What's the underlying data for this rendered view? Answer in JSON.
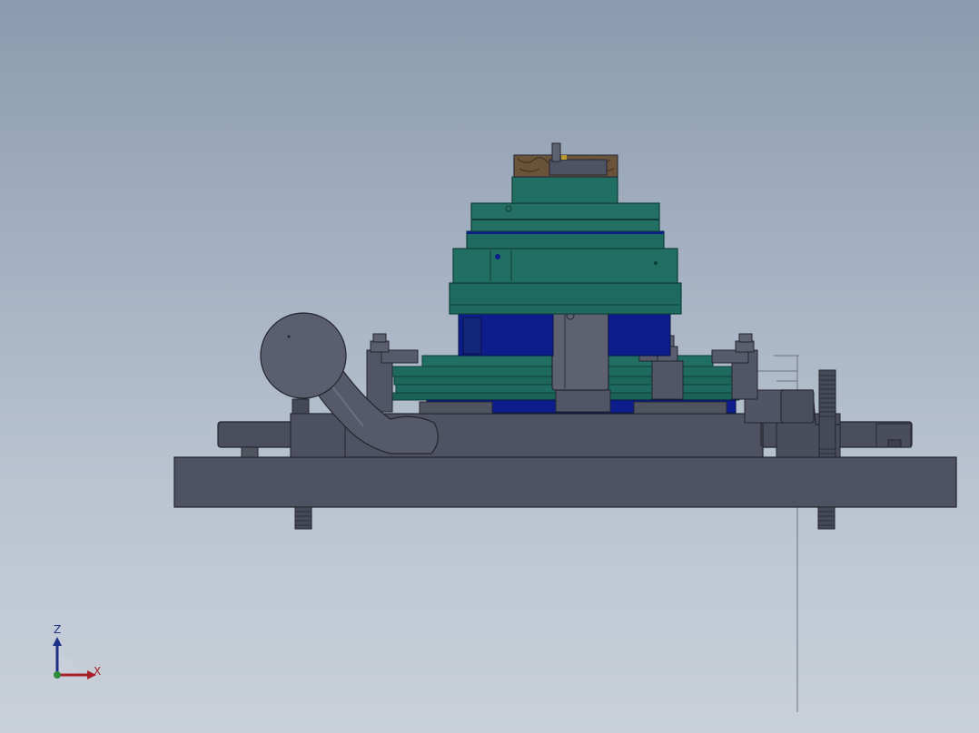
{
  "viewport": {
    "background_top": "#8b9aae",
    "background_bottom": "#c9d0d9"
  },
  "colors": {
    "steel": "#4e5262",
    "steel_dark": "#2c2f39",
    "teal": "#1f6a5e",
    "teal_dark": "#0f3f37",
    "navy": "#0d1e8c",
    "wood": "#6a5338"
  },
  "triad": {
    "z_label": "Z",
    "x_label": "X",
    "z_color": "#1e2f86",
    "x_color": "#a6202a",
    "origin_color": "#2f8a3b"
  }
}
